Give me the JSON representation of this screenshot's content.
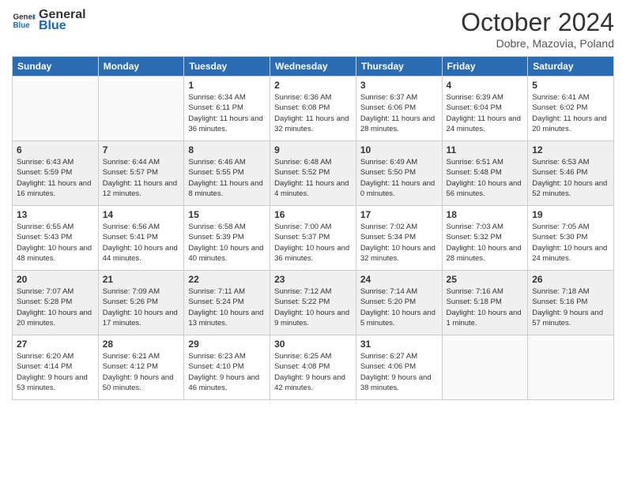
{
  "header": {
    "logo_general": "General",
    "logo_blue": "Blue",
    "month": "October 2024",
    "location": "Dobre, Mazovia, Poland"
  },
  "weekdays": [
    "Sunday",
    "Monday",
    "Tuesday",
    "Wednesday",
    "Thursday",
    "Friday",
    "Saturday"
  ],
  "weeks": [
    [
      {
        "day": "",
        "info": ""
      },
      {
        "day": "",
        "info": ""
      },
      {
        "day": "1",
        "info": "Sunrise: 6:34 AM\nSunset: 6:11 PM\nDaylight: 11 hours and 36 minutes."
      },
      {
        "day": "2",
        "info": "Sunrise: 6:36 AM\nSunset: 6:08 PM\nDaylight: 11 hours and 32 minutes."
      },
      {
        "day": "3",
        "info": "Sunrise: 6:37 AM\nSunset: 6:06 PM\nDaylight: 11 hours and 28 minutes."
      },
      {
        "day": "4",
        "info": "Sunrise: 6:39 AM\nSunset: 6:04 PM\nDaylight: 11 hours and 24 minutes."
      },
      {
        "day": "5",
        "info": "Sunrise: 6:41 AM\nSunset: 6:02 PM\nDaylight: 11 hours and 20 minutes."
      }
    ],
    [
      {
        "day": "6",
        "info": "Sunrise: 6:43 AM\nSunset: 5:59 PM\nDaylight: 11 hours and 16 minutes."
      },
      {
        "day": "7",
        "info": "Sunrise: 6:44 AM\nSunset: 5:57 PM\nDaylight: 11 hours and 12 minutes."
      },
      {
        "day": "8",
        "info": "Sunrise: 6:46 AM\nSunset: 5:55 PM\nDaylight: 11 hours and 8 minutes."
      },
      {
        "day": "9",
        "info": "Sunrise: 6:48 AM\nSunset: 5:52 PM\nDaylight: 11 hours and 4 minutes."
      },
      {
        "day": "10",
        "info": "Sunrise: 6:49 AM\nSunset: 5:50 PM\nDaylight: 11 hours and 0 minutes."
      },
      {
        "day": "11",
        "info": "Sunrise: 6:51 AM\nSunset: 5:48 PM\nDaylight: 10 hours and 56 minutes."
      },
      {
        "day": "12",
        "info": "Sunrise: 6:53 AM\nSunset: 5:46 PM\nDaylight: 10 hours and 52 minutes."
      }
    ],
    [
      {
        "day": "13",
        "info": "Sunrise: 6:55 AM\nSunset: 5:43 PM\nDaylight: 10 hours and 48 minutes."
      },
      {
        "day": "14",
        "info": "Sunrise: 6:56 AM\nSunset: 5:41 PM\nDaylight: 10 hours and 44 minutes."
      },
      {
        "day": "15",
        "info": "Sunrise: 6:58 AM\nSunset: 5:39 PM\nDaylight: 10 hours and 40 minutes."
      },
      {
        "day": "16",
        "info": "Sunrise: 7:00 AM\nSunset: 5:37 PM\nDaylight: 10 hours and 36 minutes."
      },
      {
        "day": "17",
        "info": "Sunrise: 7:02 AM\nSunset: 5:34 PM\nDaylight: 10 hours and 32 minutes."
      },
      {
        "day": "18",
        "info": "Sunrise: 7:03 AM\nSunset: 5:32 PM\nDaylight: 10 hours and 28 minutes."
      },
      {
        "day": "19",
        "info": "Sunrise: 7:05 AM\nSunset: 5:30 PM\nDaylight: 10 hours and 24 minutes."
      }
    ],
    [
      {
        "day": "20",
        "info": "Sunrise: 7:07 AM\nSunset: 5:28 PM\nDaylight: 10 hours and 20 minutes."
      },
      {
        "day": "21",
        "info": "Sunrise: 7:09 AM\nSunset: 5:26 PM\nDaylight: 10 hours and 17 minutes."
      },
      {
        "day": "22",
        "info": "Sunrise: 7:11 AM\nSunset: 5:24 PM\nDaylight: 10 hours and 13 minutes."
      },
      {
        "day": "23",
        "info": "Sunrise: 7:12 AM\nSunset: 5:22 PM\nDaylight: 10 hours and 9 minutes."
      },
      {
        "day": "24",
        "info": "Sunrise: 7:14 AM\nSunset: 5:20 PM\nDaylight: 10 hours and 5 minutes."
      },
      {
        "day": "25",
        "info": "Sunrise: 7:16 AM\nSunset: 5:18 PM\nDaylight: 10 hours and 1 minute."
      },
      {
        "day": "26",
        "info": "Sunrise: 7:18 AM\nSunset: 5:16 PM\nDaylight: 9 hours and 57 minutes."
      }
    ],
    [
      {
        "day": "27",
        "info": "Sunrise: 6:20 AM\nSunset: 4:14 PM\nDaylight: 9 hours and 53 minutes."
      },
      {
        "day": "28",
        "info": "Sunrise: 6:21 AM\nSunset: 4:12 PM\nDaylight: 9 hours and 50 minutes."
      },
      {
        "day": "29",
        "info": "Sunrise: 6:23 AM\nSunset: 4:10 PM\nDaylight: 9 hours and 46 minutes."
      },
      {
        "day": "30",
        "info": "Sunrise: 6:25 AM\nSunset: 4:08 PM\nDaylight: 9 hours and 42 minutes."
      },
      {
        "day": "31",
        "info": "Sunrise: 6:27 AM\nSunset: 4:06 PM\nDaylight: 9 hours and 38 minutes."
      },
      {
        "day": "",
        "info": ""
      },
      {
        "day": "",
        "info": ""
      }
    ]
  ]
}
